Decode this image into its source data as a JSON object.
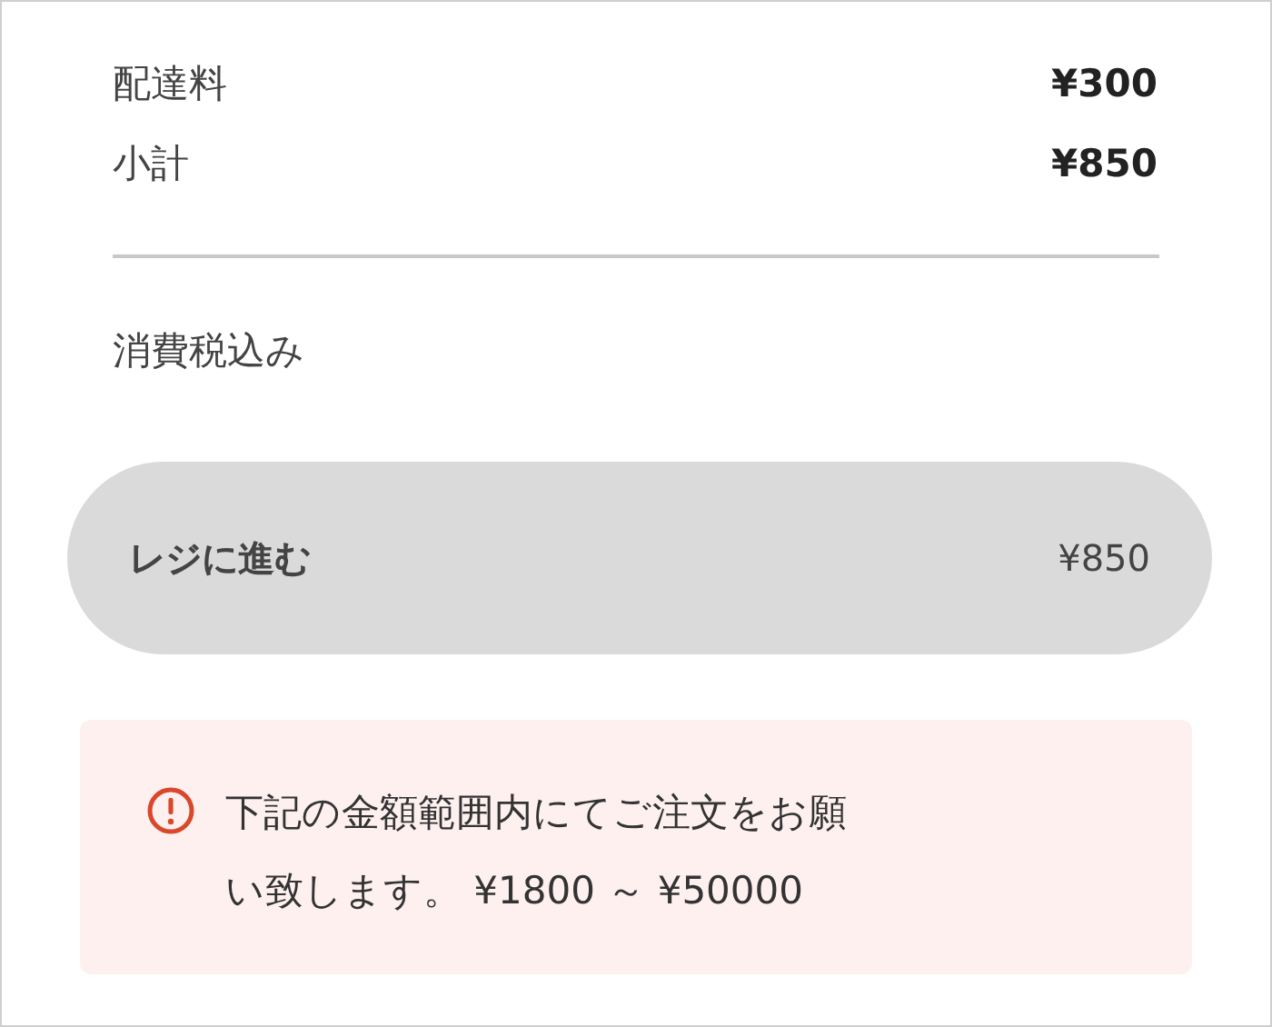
{
  "summary_rows": [
    {
      "label": "配達料",
      "value": "¥300"
    },
    {
      "label": "小計",
      "value": "¥850"
    }
  ],
  "tax_note": "消費税込み",
  "checkout_button": {
    "label": "レジに進む",
    "amount": "¥850",
    "disabled": true
  },
  "alert": {
    "message": "下記の金額範囲内にてご注文をお願い致します。 ¥1800 ～ ¥50000"
  }
}
